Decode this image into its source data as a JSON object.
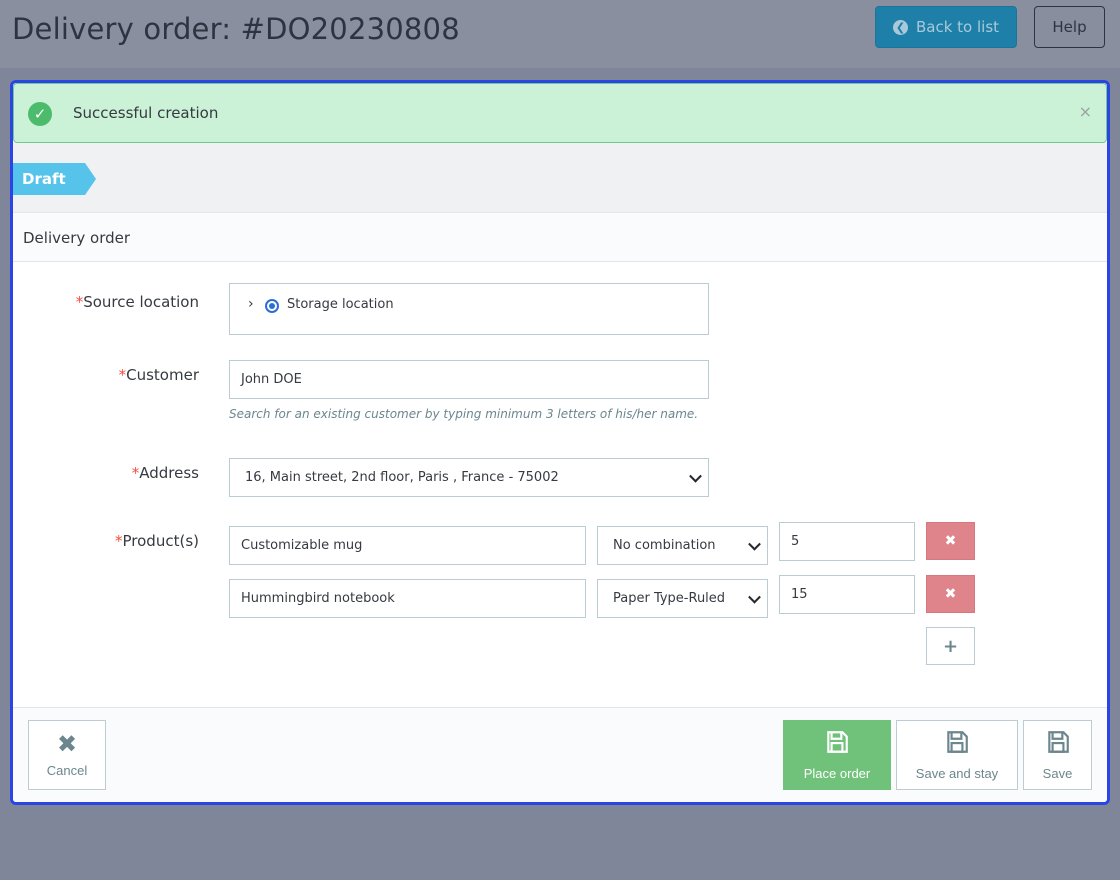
{
  "header": {
    "title": "Delivery order: #DO20230808",
    "back_label": "Back to list",
    "help_label": "Help"
  },
  "alert": {
    "message": "Successful creation",
    "close": "×"
  },
  "status": {
    "label": "Draft"
  },
  "section": {
    "title": "Delivery order"
  },
  "form": {
    "required_mark": "*",
    "source_location": {
      "label": "Source location",
      "value": "Storage location"
    },
    "customer": {
      "label": "Customer",
      "value": "John DOE",
      "hint": "Search for an existing customer by typing minimum 3 letters of his/her name."
    },
    "address": {
      "label": "Address",
      "value": "16, Main street, 2nd floor, Paris , France - 75002"
    },
    "products": {
      "label": "Product(s)",
      "rows": [
        {
          "name": "Customizable mug",
          "combination": "No combination",
          "quantity": "5"
        },
        {
          "name": "Hummingbird notebook",
          "combination": "Paper Type-Ruled",
          "quantity": "15"
        }
      ],
      "remove_icon": "✖",
      "add_icon": "+"
    }
  },
  "footer": {
    "cancel": "Cancel",
    "place_order": "Place order",
    "save_and_stay": "Save and stay",
    "save": "Save"
  },
  "colors": {
    "accent": "#1e80a8",
    "success": "#70c27a",
    "danger": "#e0848c",
    "status": "#56c3ea",
    "modal_border": "#2b44e6"
  }
}
